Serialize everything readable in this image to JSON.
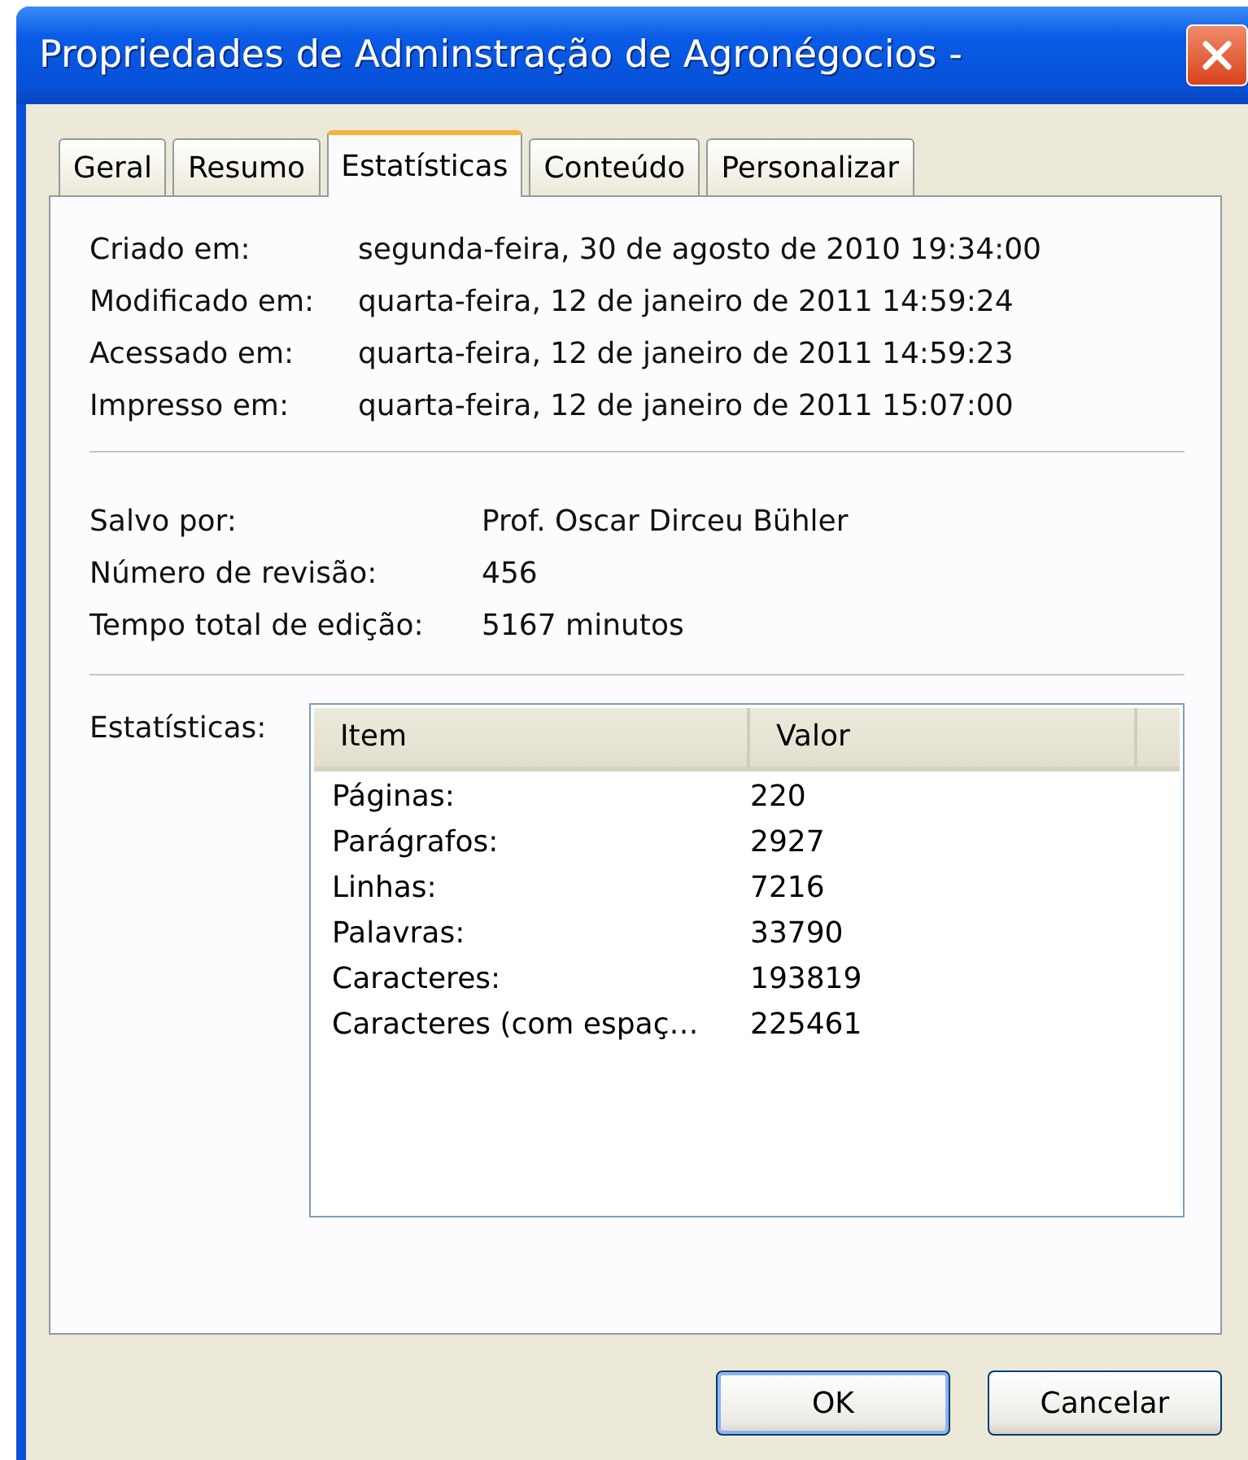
{
  "window": {
    "title": "Propriedades de Adminstração de Agronégocios -"
  },
  "tabs": [
    {
      "label": "Geral",
      "selected": false
    },
    {
      "label": "Resumo",
      "selected": false
    },
    {
      "label": "Estatísticas",
      "selected": true
    },
    {
      "label": "Conteúdo",
      "selected": false
    },
    {
      "label": "Personalizar",
      "selected": false
    }
  ],
  "dates": [
    {
      "label": "Criado em:",
      "value": "segunda-feira, 30 de agosto de 2010 19:34:00"
    },
    {
      "label": "Modificado em:",
      "value": "quarta-feira, 12 de janeiro de 2011 14:59:24"
    },
    {
      "label": "Acessado em:",
      "value": "quarta-feira, 12 de janeiro de 2011 14:59:23"
    },
    {
      "label": "Impresso em:",
      "value": "quarta-feira, 12 de janeiro de 2011 15:07:00"
    }
  ],
  "info": [
    {
      "label": "Salvo por:",
      "value": "Prof. Oscar Dirceu Bühler"
    },
    {
      "label": "Número de revisão:",
      "value": "456"
    },
    {
      "label": "Tempo total de edição:",
      "value": "5167 minutos"
    }
  ],
  "statistics": {
    "label": "Estatísticas:",
    "columns": [
      "Item",
      "Valor"
    ],
    "rows": [
      [
        "Páginas:",
        "220"
      ],
      [
        "Parágrafos:",
        "2927"
      ],
      [
        "Linhas:",
        "7216"
      ],
      [
        "Palavras:",
        "33790"
      ],
      [
        "Caracteres:",
        "193819"
      ],
      [
        "Caracteres (com espaç…",
        "225461"
      ]
    ]
  },
  "buttons": [
    {
      "label": "OK",
      "default": true
    },
    {
      "label": "Cancelar",
      "default": false
    }
  ]
}
